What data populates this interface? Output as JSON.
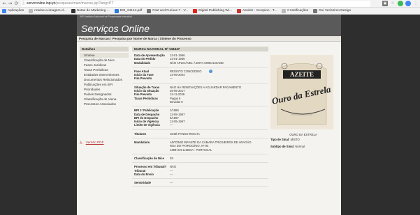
{
  "browser": {
    "url_host": "serviconline.inpi.pt",
    "url_path": "/pesquisas/main/marcas.jsp?lang=PT",
    "back_icon": "arrow-left-icon",
    "bookmarks": [
      {
        "label": "Aplicações",
        "icon": "apps-icon",
        "color": "#4285f4"
      },
      {
        "label": "rotulos-a-imagem-d...",
        "icon": "page-icon",
        "color": "#bbbbbb"
      },
      {
        "label": "Notas do Marketing ...",
        "icon": "notes-icon",
        "color": "#333333"
      },
      {
        "label": "DM_24144.pdf",
        "icon": "pdf-icon",
        "color": "#2a7ae2"
      },
      {
        "label": "Fast and Furious 7 - V...",
        "icon": "film-icon",
        "color": "#777777"
      },
      {
        "label": "Digital Publishing Wi...",
        "icon": "youtube-icon",
        "color": "#e62117"
      },
      {
        "label": "Assistir - Scorpion - T...",
        "icon": "video-icon",
        "color": "#cc3333"
      },
      {
        "label": "0 Notificações",
        "icon": "page-icon",
        "color": "#bbbbbb"
      },
      {
        "label": "Rui Veríssimo Design",
        "icon": "globe-icon",
        "color": "#777777"
      }
    ]
  },
  "site": {
    "tagline": "INPI Instituto Nacional da Propriedade Industrial",
    "brand": "Serviços Online",
    "menu_left": "Pesquisa de Marcas",
    "menu_mid": "Pesquisa por Nome de Marca",
    "menu_right": "Síntese do Processo"
  },
  "left_nav": {
    "title": "Detalhes",
    "items": [
      "Síntese",
      "Classificação de Nice",
      "Fases Jurídicas",
      "Taxas Periódicas",
      "Entidades Intervenientes",
      "Documentos Relacionados",
      "Publicações em BPI",
      "Prioridades",
      "Países Designados",
      "Classificação de Viena",
      "Processos Associados"
    ],
    "pdf_label": "Versão PDF"
  },
  "marca": {
    "title": "MARCA NACIONAL Nº 134647",
    "sections": [
      [
        {
          "k": "Data de Apresentação",
          "v": "13-01-1966"
        },
        {
          "k": "Data do Pedido",
          "v": "13-01-1966"
        },
        {
          "k": "Modalidade",
          "v": "NÃO APLICÁVEL À ESTA MODALIDADE"
        }
      ],
      [
        {
          "k": "Fase Atual",
          "v": "REGISTO CONCEDIDO"
        },
        {
          "k": "Início da Fase",
          "v": "14-09-2004"
        },
        {
          "k": "Fim Previsto",
          "v": "---"
        }
      ],
      [
        {
          "k": "Situação de Taxas",
          "v": "NÃO HÁ RENOVAÇÕES A AGUARDAR PAGAMENTO"
        },
        {
          "k": "Início da Situação",
          "v": "25-05-2017"
        },
        {
          "k": "Fim Previsto",
          "v": "13-11-2026"
        },
        {
          "k": "Taxas Periódicas",
          "v": "Pagas       6"
        },
        {
          "k": "",
          "v": "Devidas     0"
        }
      ],
      [
        {
          "k": "BPI 1ª Publicação",
          "v": "1/1966"
        },
        {
          "k": "Data de Despacho",
          "v": "12-05-1967"
        },
        {
          "k": "BPI do Despacho",
          "v": "5/1967"
        },
        {
          "k": "Início de Vigência",
          "v": "12-05-1967"
        },
        {
          "k": "Limite de Vigência",
          "v": "---"
        }
      ],
      [
        {
          "k": "Titulares",
          "v": "JOSÉ PANSO ROCHA"
        }
      ],
      [
        {
          "k": "Mandatário",
          "v": "ANTÓNIO INFANTE DA CÂMARA TRIGUEIROS DE ARAGÃO"
        },
        {
          "k": "",
          "v": "RUA DO PATROCÍNIO, Nº 94"
        },
        {
          "k": "",
          "v": "1399-019 LISBOA - PORTUGAL"
        }
      ],
      [
        {
          "k": "Classificação de Nice",
          "v": "29"
        }
      ],
      [
        {
          "k": "Processo em Tribunal?",
          "v": "NÃO"
        },
        {
          "k": "Tribunal",
          "v": "---"
        },
        {
          "k": "Data do Envio",
          "v": "---"
        }
      ],
      [
        {
          "k": "Senioridade",
          "v": "---"
        }
      ]
    ],
    "logo_text_top": "AZEITE",
    "logo_text_main": "Ouro da Estrela",
    "logo_caption": "OURO DA ESTRELA",
    "sign_type_label": "Tipo de Sinal:",
    "sign_type_value": "MISTO",
    "sign_sub_label": "Subtipo de Sinal:",
    "sign_sub_value": "Normal"
  }
}
